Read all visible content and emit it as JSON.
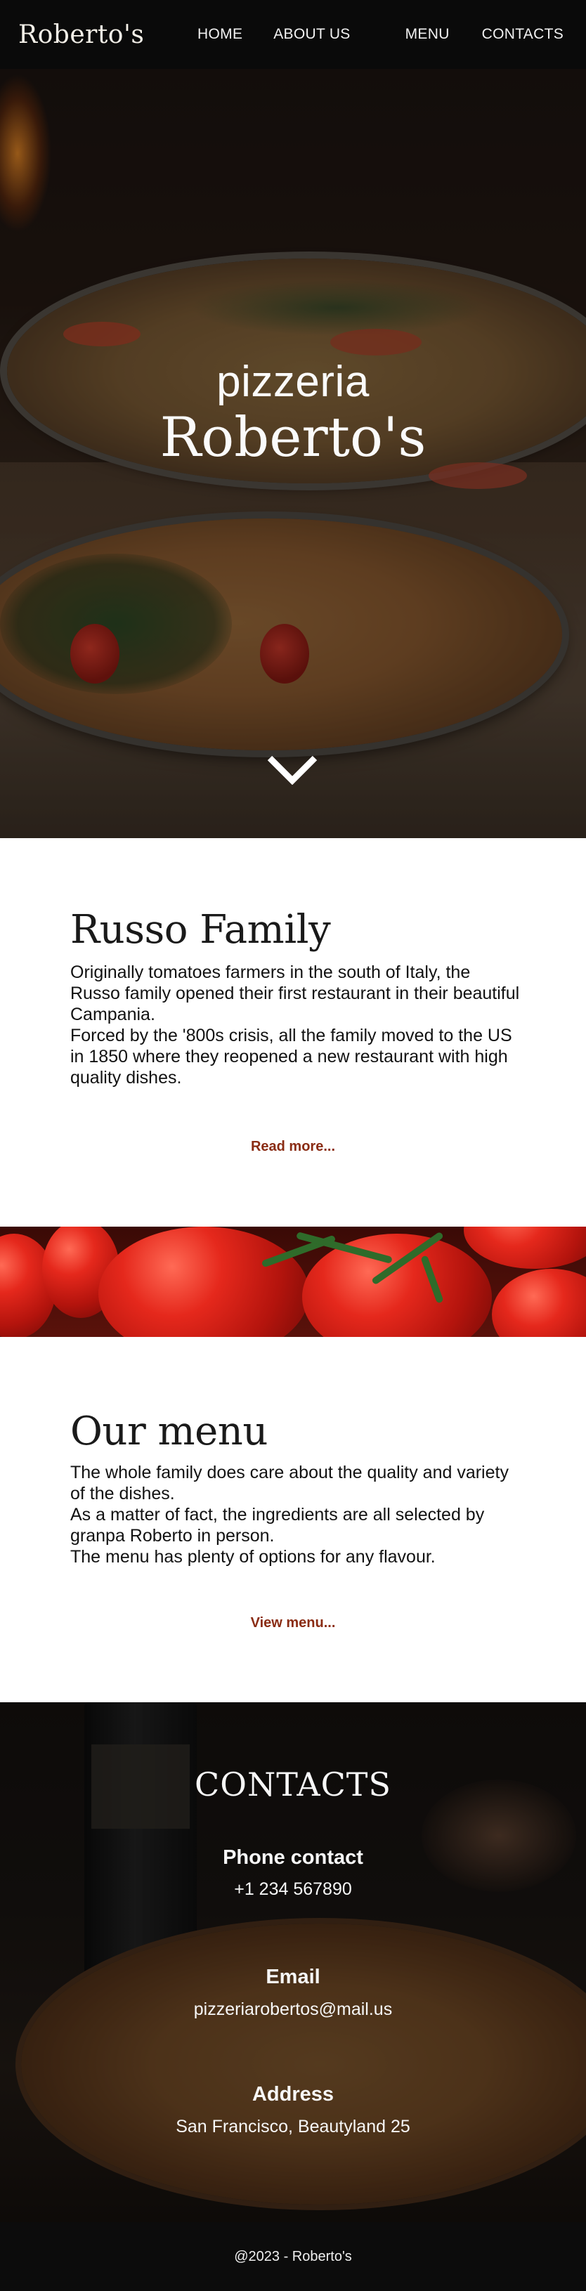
{
  "header": {
    "logo": "Roberto's",
    "nav": [
      "HOME",
      "ABOUT US",
      "MENU",
      "CONTACTS"
    ]
  },
  "hero": {
    "subtitle": "pizzeria",
    "title": "Roberto's",
    "scroll_icon": "chevron-down-icon"
  },
  "family": {
    "title": "Russo Family",
    "paragraphs": [
      "Originally tomatoes farmers in the south of Italy, the Russo family opened their first restaurant in their beautiful Campania.",
      "Forced by the '800s crisis, all the family moved to the US in 1850 where they reopened a new restaurant with high quality dishes."
    ],
    "link": "Read more..."
  },
  "menu": {
    "title": "Our menu",
    "paragraphs": [
      "The whole family does care about the quality and variety of the dishes.",
      "As a matter of fact, the ingredients are all selected by granpa Roberto in person.",
      "The menu has plenty of options for any flavour."
    ],
    "link": "View menu..."
  },
  "contacts": {
    "title": "CONTACTS",
    "phone_label": "Phone contact",
    "phone": "+1 234 567890",
    "email_label": "Email",
    "email": "pizzeriarobertos@mail.us",
    "address_label": "Address",
    "address": "San Francisco, Beautyland 25"
  },
  "footer": {
    "text": "@2023 - Roberto's"
  },
  "colors": {
    "accent": "#8a2c14",
    "header_bg": "#0a0a0a"
  }
}
